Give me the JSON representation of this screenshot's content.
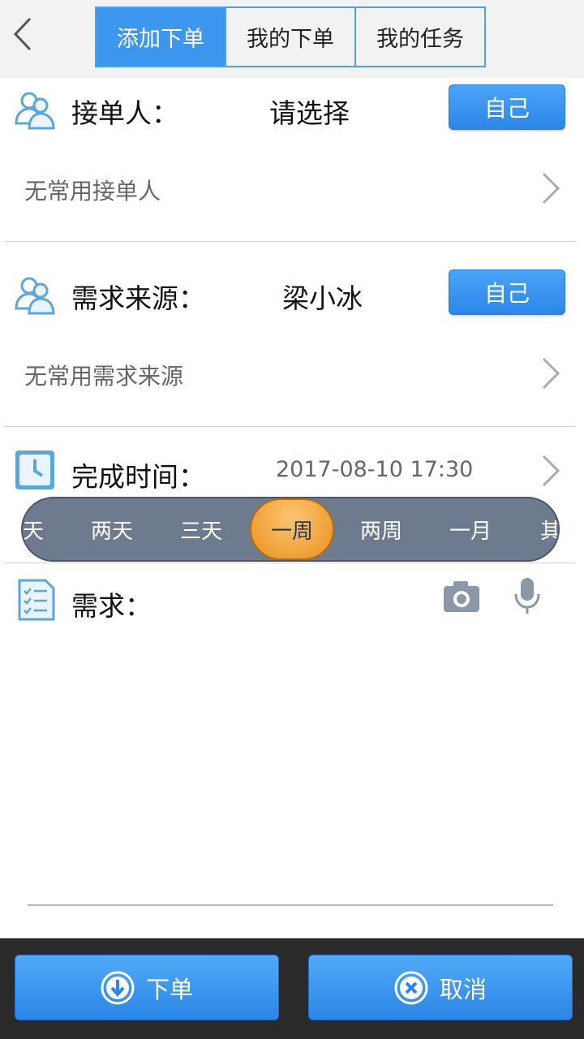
{
  "header": {
    "tabs": [
      {
        "label": "添加下单",
        "active": true
      },
      {
        "label": "我的下单",
        "active": false
      },
      {
        "label": "我的任务",
        "active": false
      }
    ]
  },
  "receiver": {
    "label": "接单人：",
    "value": "请选择",
    "self_button": "自己",
    "common_text": "无常用接单人"
  },
  "source": {
    "label": "需求来源：",
    "value": "梁小冰",
    "self_button": "自己",
    "common_text": "无常用需求来源"
  },
  "deadline": {
    "label": "完成时间：",
    "value": "2017-08-10 17:30",
    "options": [
      "天",
      "两天",
      "三天",
      "一周",
      "两周",
      "一月",
      "其"
    ],
    "selected": "一周"
  },
  "requirement": {
    "label": "需求："
  },
  "footer": {
    "submit_label": "下单",
    "cancel_label": "取消"
  },
  "colors": {
    "accent": "#3d97ee",
    "picker_bg": "#6e7b8e",
    "picker_selected": "#f0a030"
  }
}
